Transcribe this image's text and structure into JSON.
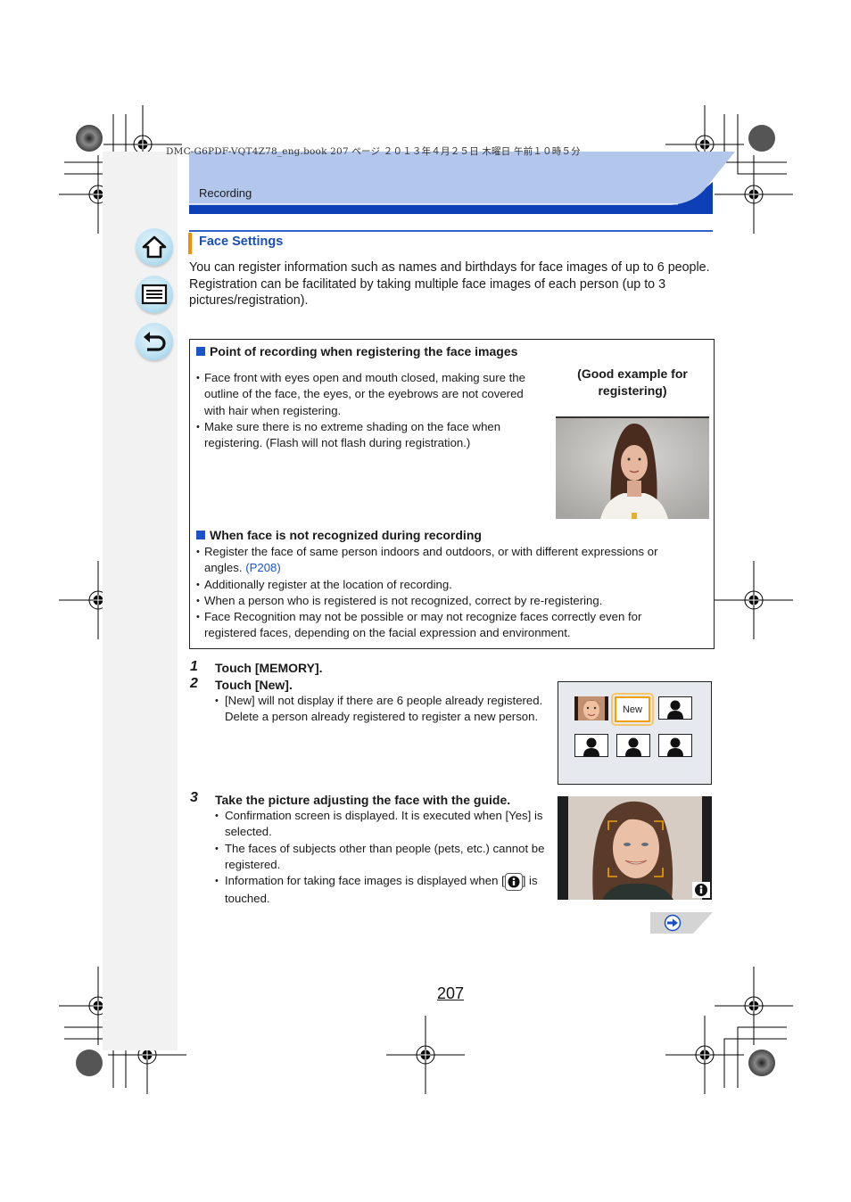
{
  "print_header": {
    "text": "DMC-G6PDF-VQT4Z78_eng.book  207 ページ  ２０１３年４月２５日  木曜日  午前１０時５分"
  },
  "header": {
    "section": "Recording",
    "colors": {
      "light": "#b3c7ec",
      "dark": "#0d3fb6"
    }
  },
  "nav": [
    {
      "name": "home",
      "icon": "home-icon"
    },
    {
      "name": "menu",
      "icon": "menu-list-icon"
    },
    {
      "name": "back",
      "icon": "back-arrow-icon"
    }
  ],
  "section_title": "Face Settings",
  "intro": [
    "You can register information such as names and birthdays for face images of up to 6 people.",
    "Registration can be facilitated by taking multiple face images of each person (up to 3 pictures/registration)."
  ],
  "box1": {
    "title": "Point of recording when registering the face images",
    "bullets": [
      "Face front with eyes open and mouth closed, making sure the outline of the face, the eyes, or the eyebrows are not covered with hair when registering.",
      "Make sure there is no extreme shading on the face when registering. (Flash will not flash during registration.)"
    ],
    "caption": "(Good example for registering)"
  },
  "box2": {
    "title": "When face is not recognized during recording",
    "bullet1_text": "Register the face of same person indoors and outdoors, or with different expressions or angles.",
    "bullet1_link": "(P208)",
    "bullets": [
      "Additionally register at the location of recording.",
      "When a person who is registered is not recognized, correct by re-registering.",
      "Face Recognition may not be possible or may not recognize faces correctly even for registered faces, depending on the facial expression and environment."
    ]
  },
  "steps": [
    {
      "num": "1",
      "text": "Touch [MEMORY].",
      "notes": []
    },
    {
      "num": "2",
      "text": "Touch [New].",
      "notes": [
        "[New] will not display if there are 6 people already registered. Delete a person already registered to register a new person."
      ]
    },
    {
      "num": "3",
      "text": "Take the picture adjusting the face with the guide.",
      "notes": [
        "Confirmation screen is displayed. It is executed when [Yes] is selected.",
        "The faces of subjects other than people (pets, etc.) cannot be registered."
      ],
      "note_info_before": "Information for taking face images is displayed when [",
      "note_info_after": "] is touched."
    }
  ],
  "screen1": {
    "new_label": "New",
    "registered_count": 1,
    "empty_slots": 4
  },
  "accent_orange": "#f0a000",
  "page_number": "207"
}
